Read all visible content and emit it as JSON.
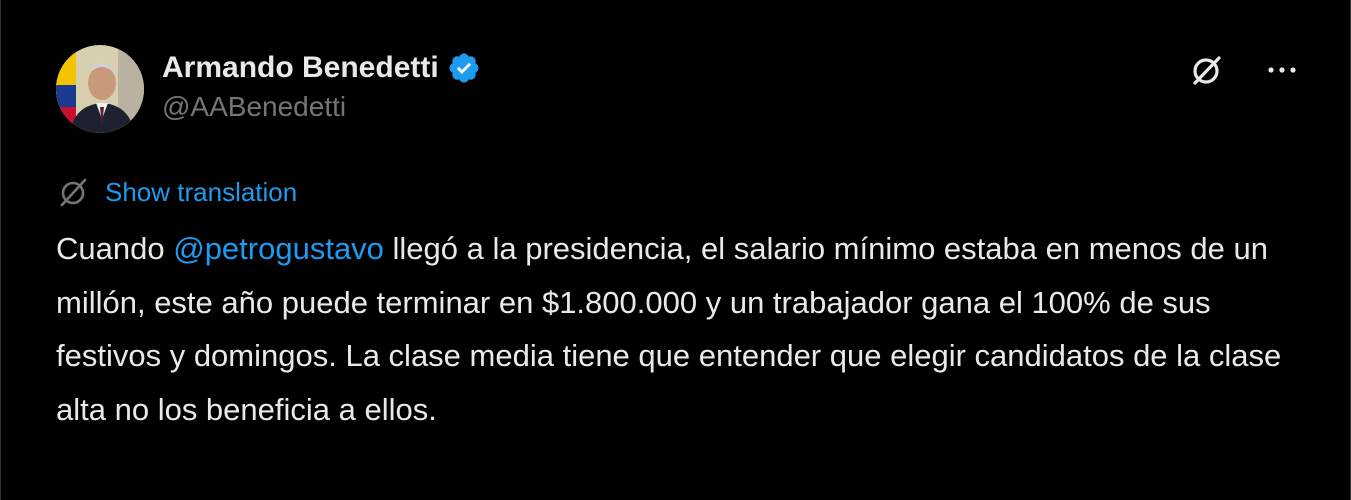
{
  "author": {
    "display_name": "Armando Benedetti",
    "handle": "@AABenedetti",
    "verified": true
  },
  "icons": {
    "verified": "verified-badge-icon",
    "grok": "grok-icon",
    "more": "more-options-icon",
    "translate": "translate-globe-icon"
  },
  "translation": {
    "label": "Show translation"
  },
  "tweet": {
    "text_before": "Cuando ",
    "mention": "@petrogustavo",
    "text_after": " llegó a la presidencia, el salario mínimo estaba en menos de un millón, este año puede terminar en $1.800.000 y un trabajador gana el 100% de sus festivos y domingos. La clase media tiene que entender que elegir candidatos de la clase alta no los beneficia a ellos."
  },
  "colors": {
    "background": "#000000",
    "text": "#e7e9ea",
    "secondary": "#71767b",
    "accent": "#1d9bf0"
  }
}
